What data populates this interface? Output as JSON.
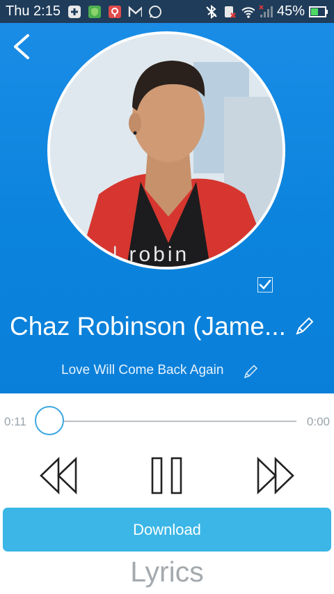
{
  "status_bar": {
    "time": "Thu 2:15",
    "battery": "45%",
    "icons": [
      "add-icon",
      "shield-app-icon",
      "maps-pin-icon",
      "gmail-icon",
      "whatsapp-icon",
      "bluetooth-off-icon",
      "sim-blocked-icon",
      "wifi-icon",
      "signal-icon",
      "battery-icon"
    ]
  },
  "header": {
    "back_icon": "chevron-left-icon",
    "album_art_caption": "z | robin",
    "title": "Chaz Robinson (Jame...",
    "subtitle": "Love Will Come Back Again",
    "selected": true,
    "accent": "#0b84dd"
  },
  "player": {
    "elapsed": "0:11",
    "total": "0:00",
    "progress": 0.0,
    "controls": [
      "rewind-icon",
      "pause-icon",
      "fast-forward-icon"
    ]
  },
  "download_label": "Download",
  "lyrics_label": "Lyrics"
}
